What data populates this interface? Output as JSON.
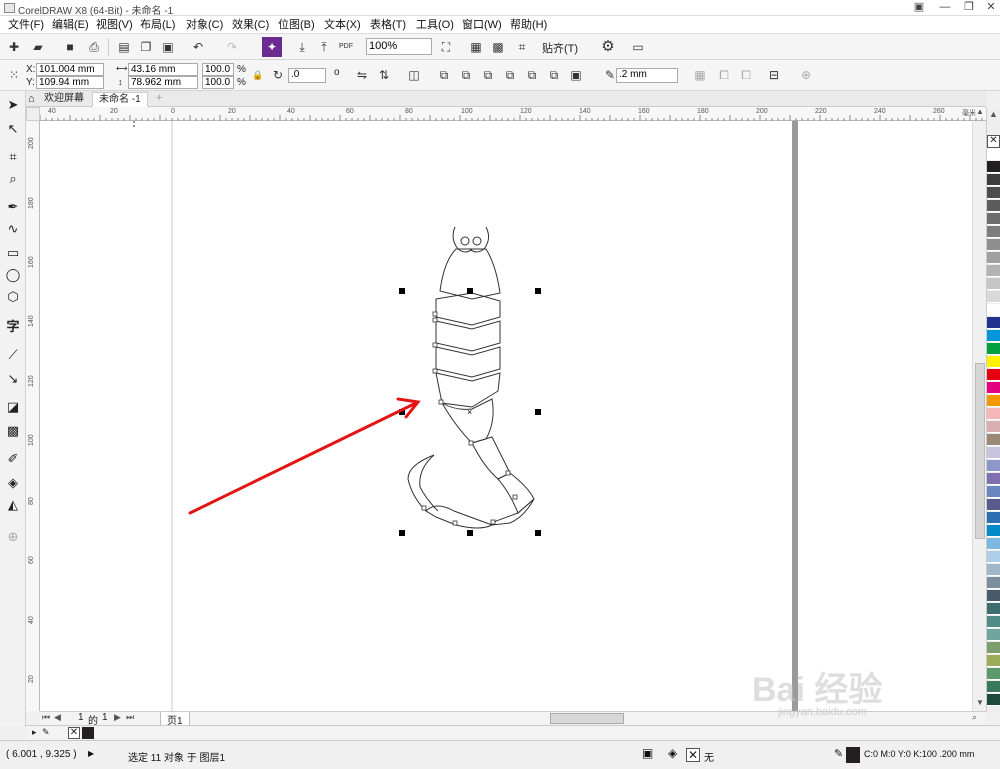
{
  "window": {
    "title": "CorelDRAW X8 (64-Bit) - 未命名 -1"
  },
  "menu": [
    "文件(F)",
    "编辑(E)",
    "视图(V)",
    "布局(L)",
    "对象(C)",
    "效果(C)",
    "位图(B)",
    "文本(X)",
    "表格(T)",
    "工具(O)",
    "窗口(W)",
    "帮助(H)"
  ],
  "toolbar": {
    "zoom_value": "100%",
    "snap_label": "贴齐(T)",
    "pdf_label": "PDF"
  },
  "property_bar": {
    "x_label": "X:",
    "x_value": "101.004 mm",
    "y_label": "Y:",
    "y_value": "109.94 mm",
    "width_value": "43.16 mm",
    "height_value": "78.962 mm",
    "scale_x": "100.0",
    "scale_y": "100.0",
    "percent": "%",
    "rotation_value": ".0",
    "degree": "o",
    "outline_width": ".2 mm"
  },
  "tabs": [
    {
      "label": "欢迎屏幕"
    },
    {
      "label": "未命名 -1"
    }
  ],
  "ruler": {
    "h_unit": "毫米",
    "h_ticks": [
      "40",
      "20",
      "0",
      "20",
      "40",
      "60",
      "80",
      "100",
      "120",
      "140",
      "160",
      "180",
      "200",
      "220",
      "240",
      "260"
    ],
    "v_ticks": [
      "200",
      "180",
      "160",
      "140",
      "120",
      "100",
      "80",
      "60",
      "40",
      "20"
    ]
  },
  "pages": {
    "current": "1",
    "of": "的",
    "total": "1",
    "tab": "页1"
  },
  "status": {
    "coordinates": "( 6.001 , 9.325 )",
    "selection": "选定 11 对象 于 图层1",
    "fill_none": "无",
    "outline_info": "C:0 M:0 Y:0 K:100  .200 mm"
  },
  "palette_colors": [
    "#ffffff",
    "#231f20",
    "#3d3d3d",
    "#4d4d4d",
    "#5c5c5c",
    "#6d6d6d",
    "#7d7d7d",
    "#8e8e8e",
    "#a0a0a0",
    "#b3b3b3",
    "#c6c6c6",
    "#d9d9d9",
    "#ffffff",
    "#23318f",
    "#0095d9",
    "#00a040",
    "#fff100",
    "#e60012",
    "#e4007f",
    "#f39800",
    "#f4b6b6",
    "#d9aeb0",
    "#9b8878",
    "#c8c4e0",
    "#8d97c9",
    "#7f6fae",
    "#6a86c1",
    "#5a5a8f",
    "#2d6fb3",
    "#0089c8",
    "#7fb8df",
    "#aecde6",
    "#9eb8c7",
    "#7d8f9e",
    "#485a6a",
    "#3d6d6e",
    "#4f8c86",
    "#6fa59c",
    "#7e9d6c",
    "#9cab55",
    "#5c9a6e",
    "#3a7a5b",
    "#1d4a3a"
  ],
  "watermark": {
    "text": "Bai 经验",
    "url": "jingyan.baidu.com"
  }
}
